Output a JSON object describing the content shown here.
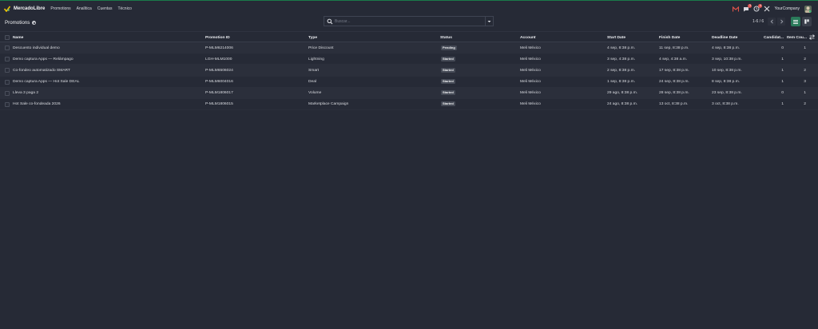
{
  "topbar": {
    "brand": "MercadoLibre",
    "menu": [
      "Promotions",
      "Analítica",
      "Cuentas",
      "Técnico"
    ],
    "notifications": {
      "messages_count": "3",
      "activities_count": "4"
    },
    "company": "YourCompany"
  },
  "control": {
    "title": "Promotions",
    "search_placeholder": "Buscar...",
    "pager": "1-6 / 6"
  },
  "table": {
    "columns": [
      "Name",
      "Promotion ID",
      "Type",
      "Status",
      "Account",
      "Start Date",
      "Finish Date",
      "Deadline Date",
      "Candidat...",
      "Item Cou..."
    ],
    "rows": [
      {
        "name": "Descuento individual demo",
        "promo_id": "P-MLM6214006",
        "type": "Price Discount",
        "status": "Pending",
        "account": "Meli México",
        "start": "4 sep, 8:38 p.m.",
        "finish": "11 sep, 8:38 p.m.",
        "deadline": "4 sep, 8:38 p.m.",
        "candidates": "0",
        "items": "1"
      },
      {
        "name": "Demo captura Apps — Relámpago",
        "promo_id": "LGH-MLM1000",
        "type": "Lightning",
        "status": "Started",
        "account": "Meli México",
        "start": "3 sep, 4:38 p.m.",
        "finish": "4 sep, 4:38 a.m.",
        "deadline": "3 sep, 10:38 p.m.",
        "candidates": "1",
        "items": "2"
      },
      {
        "name": "Co-fondeo automatizado SMART",
        "promo_id": "P-MLM6506024",
        "type": "Smart",
        "status": "Started",
        "account": "Meli México",
        "start": "2 sep, 8:38 p.m.",
        "finish": "17 sep, 8:38 p.m.",
        "deadline": "10 sep, 8:38 p.m.",
        "candidates": "1",
        "items": "2"
      },
      {
        "name": "Demo captura Apps — Hot Sale DEAL",
        "promo_id": "P-MLM6004016",
        "type": "Deal",
        "status": "Started",
        "account": "Meli México",
        "start": "1 sep, 8:38 p.m.",
        "finish": "24 sep, 8:38 p.m.",
        "deadline": "8 sep, 8:38 p.m.",
        "candidates": "1",
        "items": "3"
      },
      {
        "name": "Lleva 3 paga 2",
        "promo_id": "P-MLM1806017",
        "type": "Volume",
        "status": "Started",
        "account": "Meli México",
        "start": "29 ago, 8:38 p.m.",
        "finish": "28 sep, 8:38 p.m.",
        "deadline": "23 sep, 8:38 p.m.",
        "candidates": "0",
        "items": "1"
      },
      {
        "name": "Hot Sale co-fondeada 2026",
        "promo_id": "P-MLM1806015",
        "type": "Marketplace Campaign",
        "status": "Started",
        "account": "Meli México",
        "start": "24 ago, 8:38 p.m.",
        "finish": "13 oct, 8:38 p.m.",
        "deadline": "3 oct, 8:38 p.m.",
        "candidates": "1",
        "items": "2"
      }
    ]
  },
  "colors": {
    "background": "#262a36",
    "accent": "#2a7a5a",
    "badge": "#d9534f"
  }
}
